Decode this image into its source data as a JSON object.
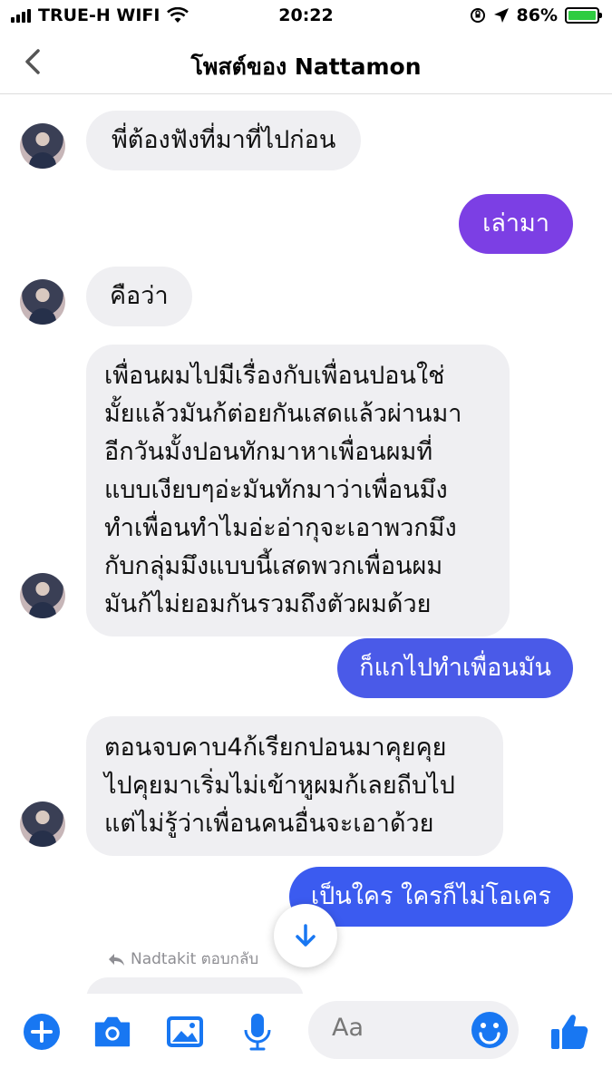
{
  "status_bar": {
    "carrier": "TRUE-H WIFI",
    "time": "20:22",
    "battery": "86%"
  },
  "header": {
    "title": "โพสต์ของ Nattamon",
    "back_icon": "chevron-left-icon"
  },
  "messages": [
    {
      "dir": "in",
      "text": "พี่ต้องฟังที่มาที่ไปก่อน"
    },
    {
      "dir": "out",
      "text": "เล่ามา",
      "color": "#7c3fe4"
    },
    {
      "dir": "in",
      "text": "คือว่า"
    },
    {
      "dir": "in",
      "lines": [
        "เพื่อนผมไปมีเรื่องกับเพื่อนปอนใช่",
        "มั้ยแล้วมันก้ต่อยกันเสดแล้วผ่านมา",
        "อีกวันมั้งปอนทักมาหาเพื่อนผมที่",
        "แบบเงียบๆอ่ะมันทักมาว่าเพื่อนมึง",
        "ทำเพื่อนทำไมอ่ะอ่ากุจะเอาพวกมึง",
        "กับกลุ่มมึงแบบนี้เสดพวกเพื่อนผม",
        "มันก้ไม่ยอมกันรวมถึงตัวผมด้วย"
      ]
    },
    {
      "dir": "out",
      "text": "ก็แกไปทำเพื่อนมัน",
      "color": "#4a5ae8"
    },
    {
      "dir": "in",
      "lines": [
        "ตอนจบคาบ4ก้เรียกปอนมาคุยคุย",
        "ไปคุยมาเริ่มไม่เข้าหูผมก้เลยถีบไป",
        "แต่ไม่รู้ว่าเพื่อนคนอื่นจะเอาด้วย"
      ]
    },
    {
      "dir": "out",
      "text": "เป็นใคร ใครก็ไม่โอเคร",
      "color": "#3b5bf0"
    }
  ],
  "reply_note": "Nadtakit ตอบกลับ",
  "composer": {
    "placeholder": "Aa"
  },
  "colors": {
    "accent": "#1877f2",
    "incoming": "#efeff2"
  }
}
